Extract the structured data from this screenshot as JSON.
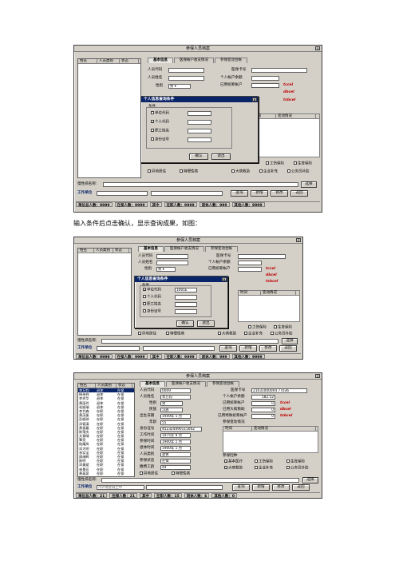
{
  "caption": "输入条件后点击确认，显示查询成果，如图：",
  "window_title": "参保人员档案",
  "tabs": [
    "基本信息",
    "医保帐户收支情况",
    "参保变动台帐"
  ],
  "list_headers": [
    "姓名",
    "人员类别",
    "状态"
  ],
  "labels": {
    "person_code": "人员代码",
    "person_name": "人员姓名",
    "gender": "性别",
    "ethnicity": "民族",
    "birth": "出生日期",
    "age": "年龄",
    "id_card": "身份证号",
    "work_date": "工作时间",
    "insured_date": "参保时间",
    "retire_date": "退休时间",
    "person_category": "人员类别",
    "insured_status": "参保状态",
    "seniority": "缴费工龄",
    "med_card": "医保卡号",
    "account_balance": "个人帐户余额",
    "used_account": "已用统筹帐户",
    "big_illness": "已用大病救助",
    "other": "已用特殊统筹帐户",
    "change_record": "参保变动情况",
    "time": "时间",
    "change_desc": "变动情况",
    "insured_types": "参保险种"
  },
  "red_notes": [
    "tccel",
    "dbcel",
    "tsbcel"
  ],
  "checkboxes": [
    "基本医疗",
    "工伤保险",
    "生育保险",
    "大病救助",
    "企业补充",
    "公务员补助",
    "异地居住",
    "特慢性病"
  ],
  "chronic_label": "慢性病名称:",
  "select_button": "选择",
  "work_unit_label": "工作单位",
  "buttons": [
    "查询",
    "新增",
    "修改",
    "返回"
  ],
  "dialog": {
    "title": "个人信息查询条件",
    "group": "条件",
    "options": [
      "单位代码",
      "个人代码",
      "职工姓名",
      "身份证号"
    ],
    "ok": "确认",
    "exit": "退出",
    "screen2_unit_code": "1001E"
  },
  "status1": [
    "单位总人数：9999",
    "在保人数：9999",
    "其中",
    "在职人数：9999",
    "退休人数：999",
    "其他人数：9999"
  ],
  "status3": [
    "单位总人数：21",
    "在保人数：21",
    "其中",
    "在职人数：15",
    "退休人数：6",
    "其他人数：0"
  ],
  "screen3": {
    "code": "0009",
    "name": "李万钧",
    "gender": "男",
    "ethnicity": "汉族",
    "birth": "1949年 1 月",
    "age": "55",
    "id_card": "452324490115002",
    "work_date": "1975年 9 月",
    "insured_date": "1900年 1 月",
    "retire_date": "1900年 1 月",
    "category": "退休",
    "status": "在保",
    "seniority": "44",
    "med_card": "21031000004 7T036",
    "balance": "182.52",
    "used1": "0",
    "used2": "0",
    "used3": "0"
  },
  "persons": [
    [
      "李万钧",
      "退休",
      "在保"
    ],
    [
      "杨伟祥",
      "退休",
      "在保"
    ],
    [
      "李秀华",
      "退休",
      "在保"
    ],
    [
      "黄丽玲",
      "退休",
      "在保"
    ],
    [
      "毛顺瑞",
      "退休",
      "在保"
    ],
    [
      "李代森",
      "在职",
      "在保"
    ],
    [
      "黄茂振",
      "在职",
      "在保"
    ],
    [
      "彭顺琼",
      "在职",
      "在保"
    ],
    [
      "邓德清",
      "在职",
      "在保"
    ],
    [
      "黄振嘉",
      "在职",
      "在保"
    ],
    [
      "陈荣庆",
      "在职",
      "在保"
    ],
    [
      "文意晴",
      "在职",
      "在保"
    ],
    [
      "覃亮",
      "在职",
      "在保"
    ],
    [
      "陆耀凤",
      "在职",
      "在保"
    ],
    [
      "邓大明",
      "在职",
      "在保"
    ],
    [
      "李实宝",
      "在职",
      "在保"
    ],
    [
      "周继辉",
      "在职",
      "在保"
    ],
    [
      "陈明",
      "在职",
      "在保"
    ],
    [
      "邓美斌",
      "在职",
      "在保"
    ],
    [
      "林景芳",
      "在职",
      "在保"
    ],
    [
      "黄泰泉",
      "在职",
      "在保"
    ]
  ],
  "screen3_workunit": "市外地驻城土巾"
}
